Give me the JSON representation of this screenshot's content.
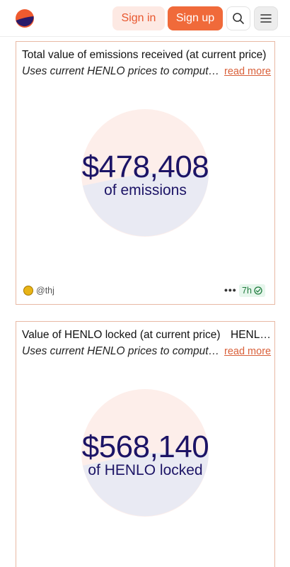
{
  "header": {
    "signin_label": "Sign in",
    "signup_label": "Sign up",
    "brand_colors": {
      "accent": "#f06a3a",
      "logo_top": "#ee5a2f",
      "logo_bottom": "#2a1a6a"
    }
  },
  "cards": [
    {
      "title": "Total value of emissions received (at current price)",
      "subtitle": "Uses current HENLO prices to compute value",
      "read_more": "read more",
      "value": "$478,408",
      "caption": "of emissions",
      "author": "@thj",
      "time": "7h",
      "chart_colors": {
        "major": "#fdeeea",
        "minor": "#e9eaf3"
      }
    },
    {
      "title": "Value of HENLO locked (at current price)",
      "title_suffix": "HENL…",
      "subtitle": "Uses current HENLO prices to compute value",
      "read_more": "read more",
      "value": "$568,140",
      "caption": "of HENLO locked",
      "chart_colors": {
        "major": "#fdeeea",
        "minor": "#e9eaf3"
      }
    }
  ]
}
